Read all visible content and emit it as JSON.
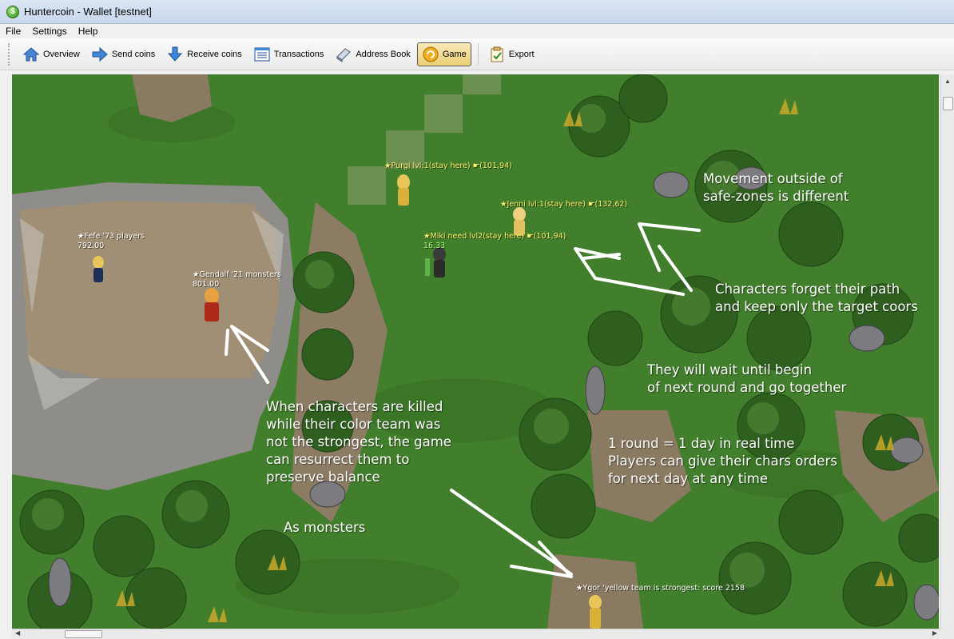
{
  "window": {
    "title": "Huntercoin - Wallet [testnet]"
  },
  "menu": {
    "items": [
      "File",
      "Settings",
      "Help"
    ]
  },
  "toolbar": {
    "overview": "Overview",
    "send": "Send coins",
    "receive": "Receive coins",
    "transactions": "Transactions",
    "address_book": "Address Book",
    "game": "Game",
    "export": "Export"
  },
  "game": {
    "players": {
      "purgi": "★Purgi   lvl:1(stay here) ☛(101,94)",
      "jenni": "★Jenni   lvl:1(stay here) ☛(132,62)",
      "miki": "★Miki   need lvl2(stay here) ☛(101,94)",
      "miki_value": "16.33",
      "fefe": "★Fefe '73 players",
      "fefe_value": "792.00",
      "gendalf": "★Gendalf '21 monsters",
      "gendalf_value": "801.00",
      "ygor": "★Ygor 'yellow team is strongest: score 2158"
    },
    "annotations": {
      "movement_1": "Movement outside of",
      "movement_2": "safe-zones is different",
      "forget_1": "Characters forget their path",
      "forget_2": "and keep only the target coors",
      "wait_1": "They will wait until begin",
      "wait_2": "of next round and go together",
      "killed_1": "When characters are killed",
      "killed_2": "while their color team was",
      "killed_3": "not the strongest, the game",
      "killed_4": "can resurrect them to",
      "killed_5": "preserve balance",
      "monsters": "As monsters",
      "round_1": "1 round = 1 day in real time",
      "round_2": "Players can give their chars orders",
      "round_3": "for next day at any time"
    }
  },
  "colors": {
    "grass": "#3f7b2a",
    "rock_plateau": "#9a8f7a",
    "label_yellow": "#fff36a",
    "annotation": "#ffffff",
    "active_tab": "#eccf76"
  }
}
